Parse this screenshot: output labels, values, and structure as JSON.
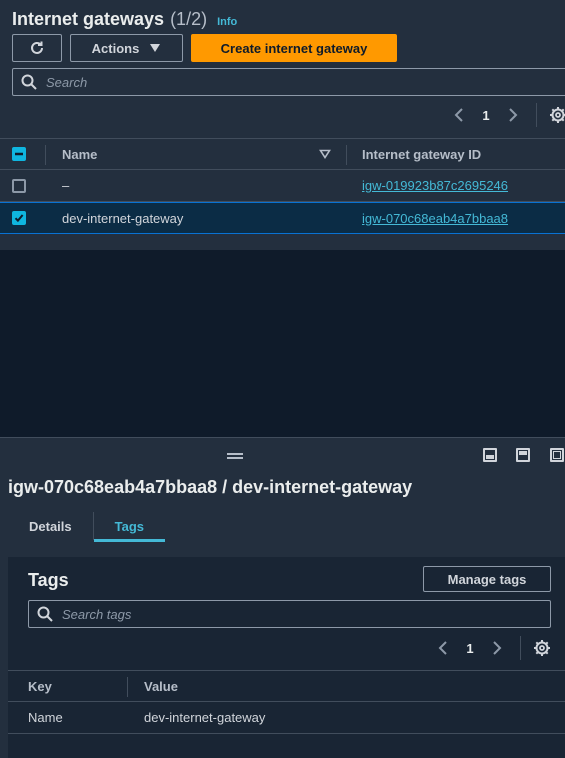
{
  "header": {
    "title": "Internet gateways",
    "count": "(1/2)",
    "info": "Info"
  },
  "toolbar": {
    "actions_label": "Actions",
    "create_label": "Create internet gateway"
  },
  "search": {
    "placeholder": "Search"
  },
  "pagination": {
    "page": "1"
  },
  "table": {
    "columns": [
      "Name",
      "Internet gateway ID"
    ],
    "rows": [
      {
        "name": "–",
        "id": "igw-019923b87c2695246",
        "selected": false
      },
      {
        "name": "dev-internet-gateway",
        "id": "igw-070c68eab4a7bbaa8",
        "selected": true
      }
    ]
  },
  "detail": {
    "title": "igw-070c68eab4a7bbaa8 / dev-internet-gateway",
    "tabs": [
      "Details",
      "Tags"
    ],
    "active_tab": "Tags",
    "tags_title": "Tags",
    "manage_label": "Manage tags",
    "search_placeholder": "Search tags",
    "page": "1",
    "columns": [
      "Key",
      "Value"
    ],
    "rows": [
      {
        "key": "Name",
        "value": "dev-internet-gateway"
      }
    ]
  },
  "colors": {
    "primary": "#ff9900",
    "link": "#44b9d6",
    "panel": "#232f3e",
    "background": "#0f1b2a"
  }
}
